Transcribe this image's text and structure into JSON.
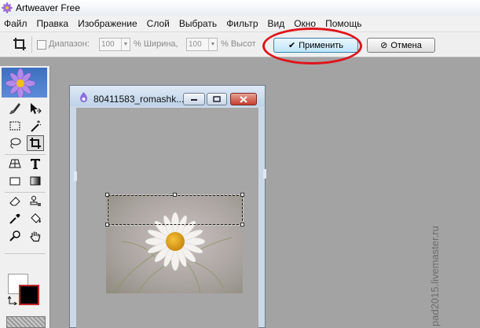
{
  "window": {
    "title": "Artweaver Free"
  },
  "menu": {
    "items": [
      {
        "label": "Файл"
      },
      {
        "label": "Правка"
      },
      {
        "label": "Изображение"
      },
      {
        "label": "Слой"
      },
      {
        "label": "Выбрать"
      },
      {
        "label": "Фильтр"
      },
      {
        "label": "Вид"
      },
      {
        "label": "Окно"
      },
      {
        "label": "Помощь"
      }
    ]
  },
  "options": {
    "range_label": "Диапазон:",
    "width_value": "100",
    "width_label": "% Ширина,",
    "height_value": "100",
    "height_label": "% Высот",
    "apply_label": "Применить",
    "cancel_label": "Отмена",
    "highlight_color": "#e0141b"
  },
  "document": {
    "title": "80411583_romashk..."
  },
  "tools": [
    "brush-icon",
    "move-icon",
    "rect-select-icon",
    "magic-wand-icon",
    "lasso-icon",
    "crop-icon",
    "perspective-icon",
    "text-icon",
    "rectangle-shape-icon",
    "gradient-icon",
    "eraser-icon",
    "clone-stamp-icon",
    "eyedropper-icon",
    "paint-bucket-icon",
    "zoom-icon",
    "hand-icon"
  ],
  "colors": {
    "foreground": "#000000",
    "background": "#ffffff",
    "accent": "#3c7fb1"
  },
  "watermark": {
    "text": "pad2015.livemaster.ru"
  }
}
